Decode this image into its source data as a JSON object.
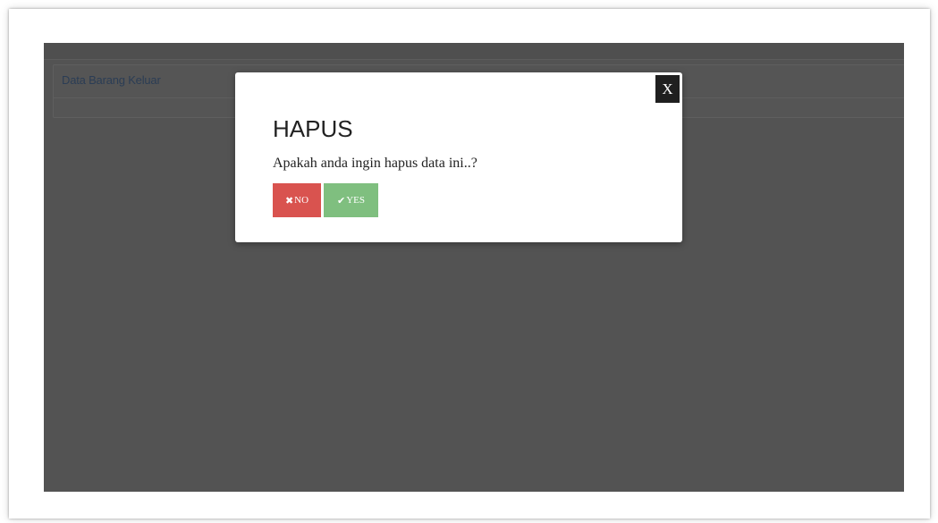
{
  "page": {
    "panel_heading": "Data Barang Keluar"
  },
  "modal": {
    "close_label": "X",
    "title": "HAPUS",
    "message": "Apakah anda ingin hapus data ini..?",
    "no_icon": "✖",
    "no_label": "NO",
    "yes_icon": "✔",
    "yes_label": "YES"
  },
  "icons": {
    "no": "times-icon",
    "yes": "check-icon"
  },
  "colors": {
    "overlay": "#535353",
    "no_button": "#d9534f",
    "yes_button": "#7fbf7f",
    "close_button": "#1f1f1f"
  }
}
